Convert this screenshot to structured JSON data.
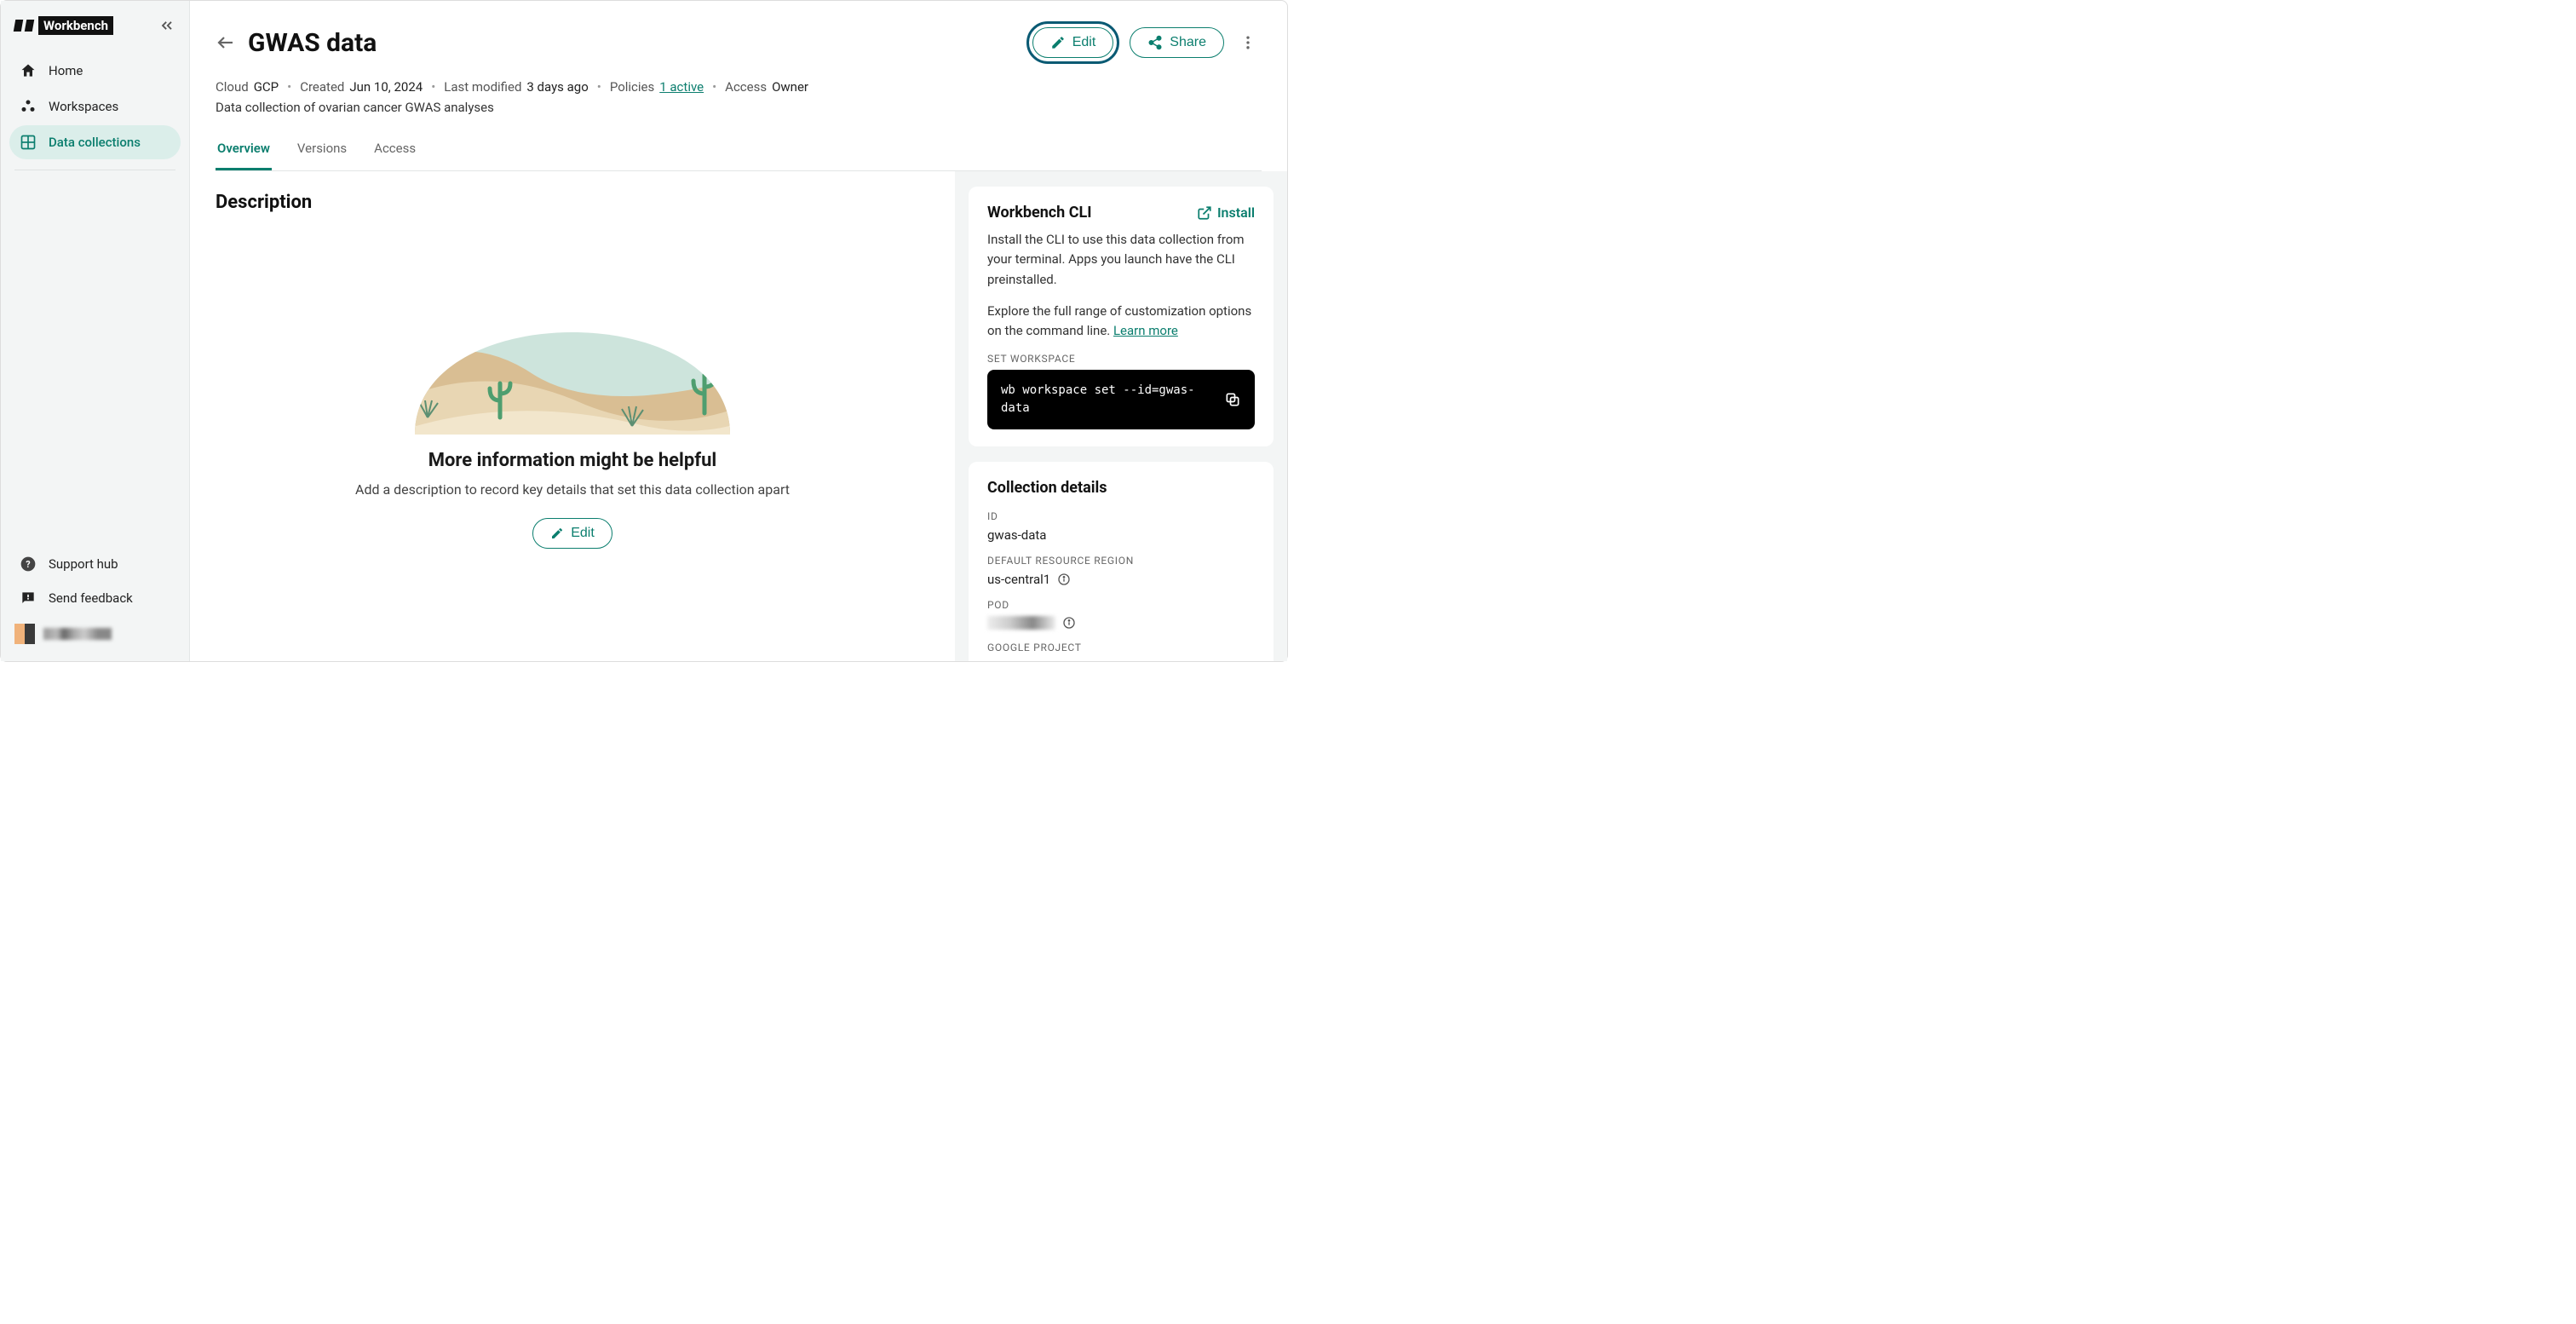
{
  "brand": {
    "name": "Workbench"
  },
  "sidebar": {
    "items": [
      {
        "label": "Home"
      },
      {
        "label": "Workspaces"
      },
      {
        "label": "Data collections"
      }
    ],
    "footer": [
      {
        "label": "Support hub"
      },
      {
        "label": "Send feedback"
      }
    ]
  },
  "header": {
    "title": "GWAS data",
    "edit_label": "Edit",
    "share_label": "Share",
    "meta": {
      "cloud_label": "Cloud",
      "cloud_value": "GCP",
      "created_label": "Created",
      "created_value": "Jun 10, 2024",
      "modified_label": "Last modified",
      "modified_value": "3 days ago",
      "policies_label": "Policies",
      "policies_link": "1 active",
      "access_label": "Access",
      "access_value": "Owner"
    },
    "description": "Data collection of ovarian cancer GWAS analyses"
  },
  "tabs": [
    {
      "label": "Overview"
    },
    {
      "label": "Versions"
    },
    {
      "label": "Access"
    }
  ],
  "content": {
    "section_title": "Description",
    "empty_title": "More information might be helpful",
    "empty_sub": "Add a description to record key details that set this data collection apart",
    "empty_edit_label": "Edit"
  },
  "cli": {
    "title": "Workbench CLI",
    "install_label": "Install",
    "desc1": "Install the CLI to use this data collection from your terminal. Apps you launch have the CLI preinstalled.",
    "desc2_prefix": "Explore the full range of customization options on the command line. ",
    "learn_more": "Learn more",
    "set_workspace_label": "SET WORKSPACE",
    "command": "wb workspace set --id=gwas-\ndata"
  },
  "details": {
    "title": "Collection details",
    "id_label": "ID",
    "id_value": "gwas-data",
    "region_label": "DEFAULT RESOURCE REGION",
    "region_value": "us-central1",
    "pod_label": "POD",
    "project_label": "GOOGLE PROJECT"
  }
}
